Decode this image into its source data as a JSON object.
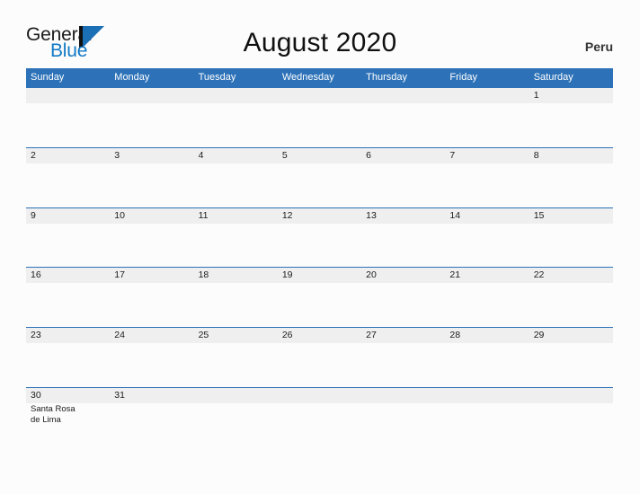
{
  "brand": {
    "name_part1": "General",
    "name_part2": "Blue",
    "mark_icon": "triangle-flag-icon"
  },
  "header": {
    "title": "August 2020",
    "country": "Peru"
  },
  "calendar": {
    "weekdays": [
      "Sunday",
      "Monday",
      "Tuesday",
      "Wednesday",
      "Thursday",
      "Friday",
      "Saturday"
    ],
    "accent_color": "#2d72b8",
    "band_color": "#efefef",
    "weeks": [
      {
        "days": [
          {
            "num": "",
            "event": ""
          },
          {
            "num": "",
            "event": ""
          },
          {
            "num": "",
            "event": ""
          },
          {
            "num": "",
            "event": ""
          },
          {
            "num": "",
            "event": ""
          },
          {
            "num": "",
            "event": ""
          },
          {
            "num": "1",
            "event": ""
          }
        ]
      },
      {
        "days": [
          {
            "num": "2",
            "event": ""
          },
          {
            "num": "3",
            "event": ""
          },
          {
            "num": "4",
            "event": ""
          },
          {
            "num": "5",
            "event": ""
          },
          {
            "num": "6",
            "event": ""
          },
          {
            "num": "7",
            "event": ""
          },
          {
            "num": "8",
            "event": ""
          }
        ]
      },
      {
        "days": [
          {
            "num": "9",
            "event": ""
          },
          {
            "num": "10",
            "event": ""
          },
          {
            "num": "11",
            "event": ""
          },
          {
            "num": "12",
            "event": ""
          },
          {
            "num": "13",
            "event": ""
          },
          {
            "num": "14",
            "event": ""
          },
          {
            "num": "15",
            "event": ""
          }
        ]
      },
      {
        "days": [
          {
            "num": "16",
            "event": ""
          },
          {
            "num": "17",
            "event": ""
          },
          {
            "num": "18",
            "event": ""
          },
          {
            "num": "19",
            "event": ""
          },
          {
            "num": "20",
            "event": ""
          },
          {
            "num": "21",
            "event": ""
          },
          {
            "num": "22",
            "event": ""
          }
        ]
      },
      {
        "days": [
          {
            "num": "23",
            "event": ""
          },
          {
            "num": "24",
            "event": ""
          },
          {
            "num": "25",
            "event": ""
          },
          {
            "num": "26",
            "event": ""
          },
          {
            "num": "27",
            "event": ""
          },
          {
            "num": "28",
            "event": ""
          },
          {
            "num": "29",
            "event": ""
          }
        ]
      },
      {
        "days": [
          {
            "num": "30",
            "event": "Santa Rosa de Lima"
          },
          {
            "num": "31",
            "event": ""
          },
          {
            "num": "",
            "event": ""
          },
          {
            "num": "",
            "event": ""
          },
          {
            "num": "",
            "event": ""
          },
          {
            "num": "",
            "event": ""
          },
          {
            "num": "",
            "event": ""
          }
        ]
      }
    ]
  }
}
